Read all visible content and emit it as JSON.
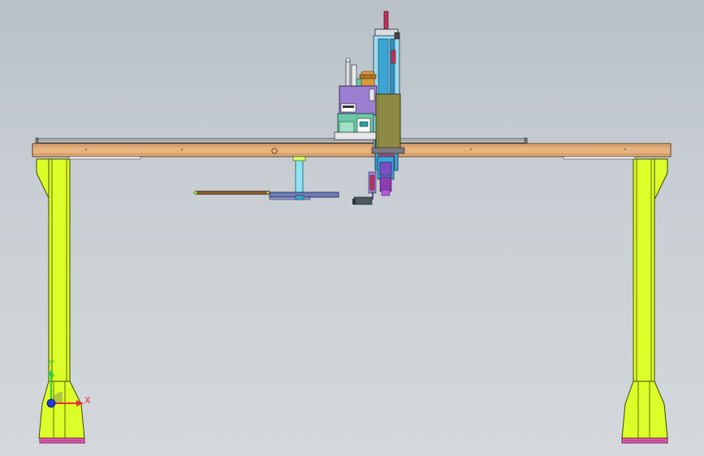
{
  "viewport": {
    "background_top": "#b9c0c7",
    "background_bottom": "#d4d8dc"
  },
  "colors": {
    "beam": "#e7b27d",
    "beam_edge": "#5a3b1f",
    "leg": "#dcff2a",
    "leg_edge": "#3d4a00",
    "foot": "#e35fb0",
    "carriage_olive": "#8d8b43",
    "head_purple": "#9b7fd0",
    "teal": "#6bc7a8",
    "rail_blue": "#3aa6d6",
    "rail_red": "#c0305a",
    "arm": "#6d7cb6",
    "rod": "#8a5a2a",
    "column": "#8fe4f3"
  },
  "triad": {
    "x_label": "X",
    "y_label": "Y",
    "x_color": "#e53030",
    "y_color": "#2ecc40",
    "z_color": "#1f3bd6"
  },
  "icons": {
    "triad": "coordinate-triad-icon"
  }
}
